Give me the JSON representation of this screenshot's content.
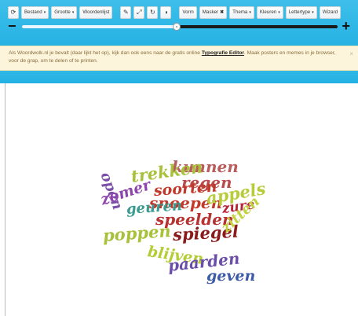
{
  "toolbar": {
    "refresh_icon": "refresh-icon",
    "bestand": "Bestand",
    "grootte": "Grootte",
    "woordenlijst": "Woordenlijst",
    "edit_icon": "pencil-icon",
    "expand_icon": "expand-icon",
    "redo_icon": "redo-icon",
    "contrast_icon": "contrast-icon",
    "vorm": "Vorm",
    "masker": "Masker",
    "thema": "Thema",
    "kleuren": "Kleuren",
    "lettertype": "Lettertype",
    "wizard": "Wizard"
  },
  "slider": {
    "value": 0.49
  },
  "notice": {
    "text_before": "Als Woordwolk.nl je bevalt (daar lijkt het op), kijk dan ook eens naar de gratis online ",
    "link": "Typografie Editor",
    "text_after": ". Maak posters en memes in je browser, voor de grap, om te delen of te printen.",
    "close": "×"
  },
  "cloud": {
    "words": [
      {
        "text": "kunnen",
        "color": "#b85c5c"
      },
      {
        "text": "trekken",
        "color": "#a8c13a"
      },
      {
        "text": "regen",
        "color": "#b94b4b"
      },
      {
        "text": "open",
        "color": "#7b4fa8"
      },
      {
        "text": "soorten",
        "color": "#c0392b"
      },
      {
        "text": "zomer",
        "color": "#8e44ad"
      },
      {
        "text": "snoepen",
        "color": "#c0392b"
      },
      {
        "text": "appels",
        "color": "#b8cc3a"
      },
      {
        "text": "geuren",
        "color": "#3a9a8f"
      },
      {
        "text": "zure",
        "color": "#b8233a"
      },
      {
        "text": "speelden",
        "color": "#b83232"
      },
      {
        "text": "poppen",
        "color": "#a8c13a"
      },
      {
        "text": "spiegel",
        "color": "#8b1a1a"
      },
      {
        "text": "zitten",
        "color": "#c2d23e"
      },
      {
        "text": "blijven",
        "color": "#b4cc35"
      },
      {
        "text": "paarden",
        "color": "#6b4ea8"
      },
      {
        "text": "geven",
        "color": "#3c5aa8"
      }
    ]
  }
}
